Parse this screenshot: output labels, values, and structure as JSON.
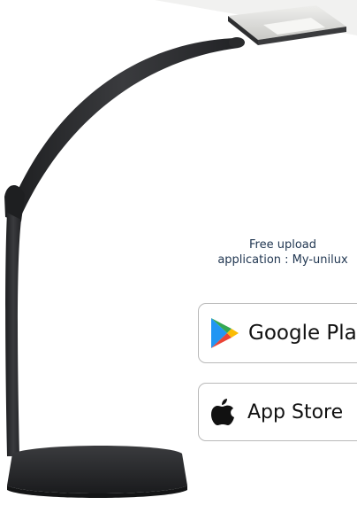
{
  "promo": {
    "line1": "Free upload",
    "line2": "application : My-unilux"
  },
  "stores": {
    "google_play_label": "Google Play",
    "app_store_label": "App Store"
  },
  "colors": {
    "lamp_body": "#2a2b2d",
    "lamp_head_top": "#d9d9d7",
    "text": "#1f3550",
    "button_border": "#b9b9b9"
  },
  "icons": {
    "google_play": "google-play-icon",
    "app_store": "apple-icon"
  }
}
